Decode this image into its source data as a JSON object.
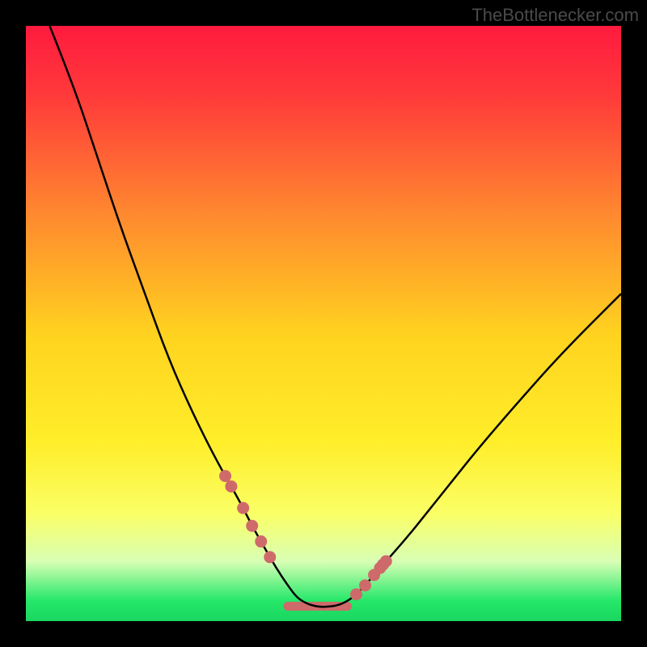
{
  "attribution": "TheBottlenecker.com",
  "chart_data": {
    "type": "line",
    "title": "",
    "xlabel": "",
    "ylabel": "",
    "xlim": [
      0,
      100
    ],
    "ylim": [
      0,
      100
    ],
    "gradient_stops": [
      {
        "pos": 0.0,
        "color": "#ff1a3f"
      },
      {
        "pos": 0.12,
        "color": "#ff3b3a"
      },
      {
        "pos": 0.32,
        "color": "#ff8a2f"
      },
      {
        "pos": 0.52,
        "color": "#ffd31f"
      },
      {
        "pos": 0.7,
        "color": "#ffee2a"
      },
      {
        "pos": 0.82,
        "color": "#faff66"
      },
      {
        "pos": 0.9,
        "color": "#d8ffb5"
      },
      {
        "pos": 0.965,
        "color": "#26e86a"
      },
      {
        "pos": 1.0,
        "color": "#19d65f"
      }
    ],
    "series": [
      {
        "name": "bottleneck-curve",
        "x": [
          4,
          8,
          12,
          16,
          20,
          24,
          28,
          32,
          36,
          38,
          40,
          42,
          44,
          45.5,
          47,
          49,
          51,
          53,
          55,
          57,
          60,
          64,
          68,
          72,
          76,
          82,
          90,
          100
        ],
        "y": [
          100,
          90,
          78,
          66,
          55,
          44,
          35,
          27,
          20,
          16,
          12.5,
          9,
          6,
          4,
          3,
          2.4,
          2.4,
          2.8,
          4,
          6,
          9.5,
          14,
          19,
          24,
          29,
          36,
          45,
          55
        ]
      }
    ],
    "left_markers_x": [
      33.5,
      34.5,
      36.5,
      38,
      39.5,
      41
    ],
    "right_markers_x": [
      55.5,
      57,
      58.5,
      59.5,
      60,
      60.5
    ],
    "flat_segment": {
      "x0": 44,
      "x1": 54,
      "y": 2.5
    },
    "marker_color": "#cf6a6a",
    "curve_color": "#000000"
  }
}
